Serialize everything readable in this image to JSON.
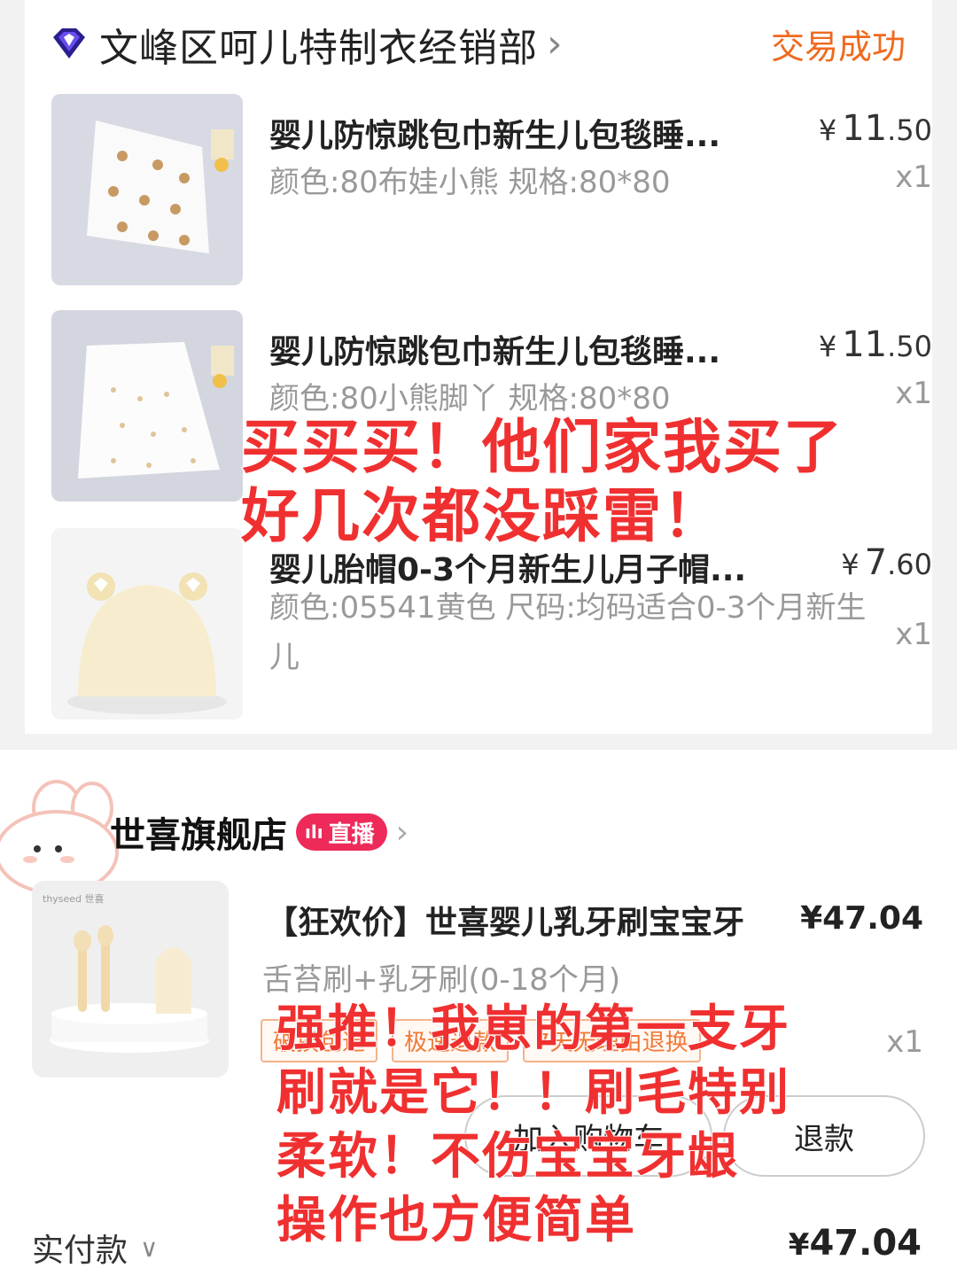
{
  "store1": {
    "name": "文峰区呵儿特制衣经销部",
    "status": "交易成功",
    "items": [
      {
        "title": "婴儿防惊跳包巾新生儿包毯睡...",
        "price_int": "11",
        "price_dec": ".50",
        "spec": "颜色:80布娃小熊 规格:80*80",
        "qty": "x1"
      },
      {
        "title": "婴儿防惊跳包巾新生儿包毯睡...",
        "price_int": "11",
        "price_dec": ".50",
        "spec": "颜色:80小熊脚丫 规格:80*80",
        "qty": "x1"
      },
      {
        "title": "婴儿胎帽0-3个月新生儿月子帽...",
        "price_int": "7",
        "price_dec": ".60",
        "spec": "颜色:05541黄色 尺码:均码适合0-3个月新生儿",
        "qty": "x1"
      }
    ],
    "currency": "¥"
  },
  "store2": {
    "name": "世喜旗舰店",
    "live_label": "直播",
    "product_image_text": "thyseed 世喜",
    "item": {
      "title": "【狂欢价】世喜婴儿乳牙刷宝宝牙",
      "price": "¥47.04",
      "spec": "舌苔刷+乳牙刷(0-18个月)",
      "tags": [
        "破损包退",
        "极速退款",
        "7天无理由退换"
      ],
      "qty": "x1"
    },
    "buttons": {
      "cart": "加入购物车",
      "refund": "退款"
    },
    "paid_label": "实付款",
    "total": "47.04",
    "currency": "¥"
  },
  "overlays": {
    "top": [
      "买买买！他们家我买了",
      "好几次都没踩雷！"
    ],
    "bottom": [
      "强推！我崽的第一支牙",
      "刷就是它！！刷毛特别",
      "柔软！不伤宝宝牙龈",
      "操作也方便简单"
    ]
  },
  "colors": {
    "status": "#f06a1e",
    "overlay": "#f03030",
    "live_badge": "#ee2a5a"
  }
}
